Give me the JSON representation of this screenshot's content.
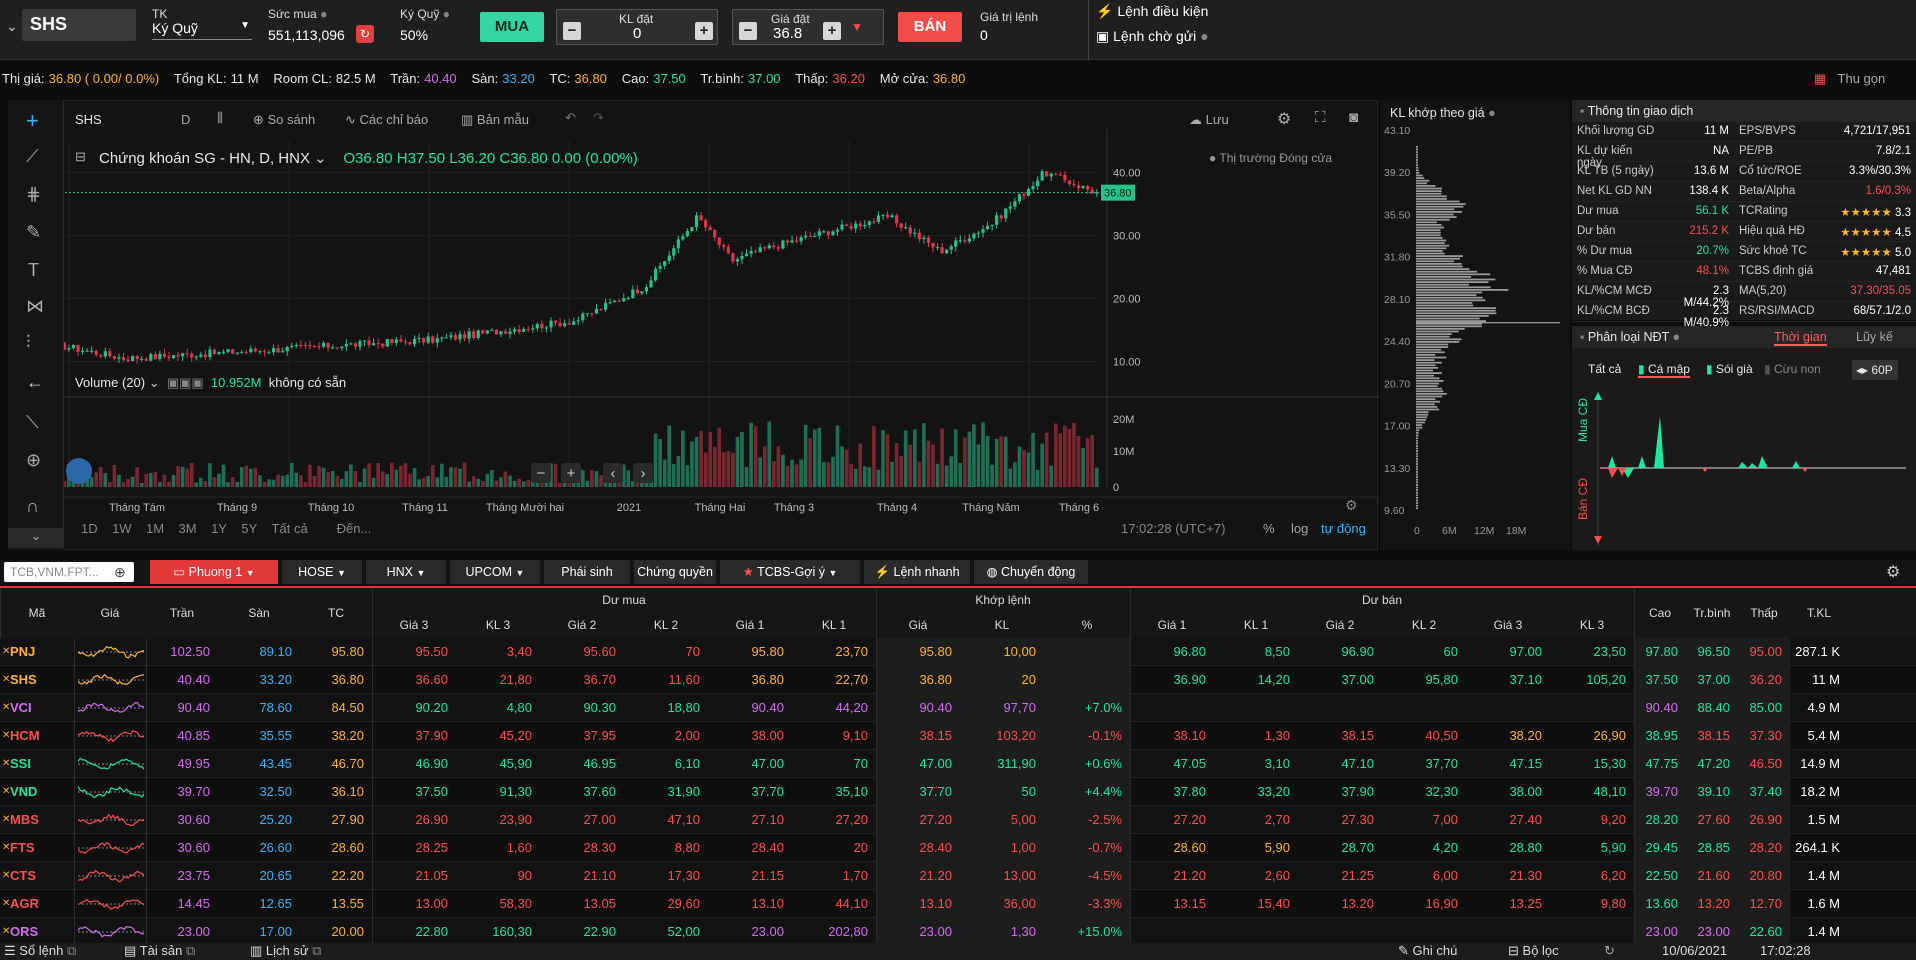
{
  "order": {
    "symbol": "SHS",
    "tk_label": "TK",
    "tk_value": "Ký Quỹ",
    "sucmua_label": "Sức mua",
    "sucmua_value": "551,113,096",
    "kyquy_label": "Ký Quỹ",
    "kyquy_value": "50%",
    "buy": "MUA",
    "kl_label": "KL đặt",
    "kl_value": "0",
    "gia_label": "Giá đặt",
    "gia_value": "36.8",
    "sell": "BÁN",
    "gtl_label": "Giá trị lệnh",
    "gtl_value": "0",
    "cond": "Lệnh điều kiện",
    "pending": "Lệnh chờ gửi"
  },
  "ticker": {
    "thigia_l": "Thị giá:",
    "thigia_v": "36.80 ( 0.00/ 0.0%)",
    "tongkl_l": "Tổng KL:",
    "tongkl_v": "11 M",
    "room_l": "Room CL:",
    "room_v": "82.5 M",
    "tran_l": "Trần:",
    "tran_v": "40.40",
    "san_l": "Sàn:",
    "san_v": "33.20",
    "tc_l": "TC:",
    "tc_v": "36.80",
    "cao_l": "Cao:",
    "cao_v": "37.50",
    "tb_l": "Tr.bình:",
    "tb_v": "37.00",
    "thap_l": "Thấp:",
    "thap_v": "36.20",
    "mo_l": "Mở cửa:",
    "mo_v": "36.80",
    "collapse": "Thu gọn"
  },
  "chart": {
    "sym": "SHS",
    "interval": "D",
    "compare": "So sánh",
    "indicators": "Các chỉ báo",
    "template": "Bản mẫu",
    "save": "Lưu",
    "name": "Chứng khoán SG - HN, D, HNX",
    "o": "O36.80",
    "h": "H37.50",
    "l": "L36.20",
    "c": "C36.80",
    "chg": "0.00 (0.00%)",
    "market": "Thị trường Đóng cửa",
    "vol_label": "Volume (20)",
    "vol_value": "10.952M",
    "vol_na": "không có sẵn",
    "last": "36.80",
    "yticks": [
      "40.00",
      "30.00",
      "20.00",
      "10.00"
    ],
    "vticks": [
      "20M",
      "10M",
      "0"
    ],
    "months": [
      "Tháng Tám",
      "Tháng 9",
      "Tháng 10",
      "Tháng 11",
      "Tháng Mười hai",
      "2021",
      "Tháng Hai",
      "Tháng 3",
      "Tháng 4",
      "Tháng Năm",
      "Tháng 6"
    ],
    "ranges": [
      "1D",
      "1W",
      "1M",
      "3M",
      "1Y",
      "5Y",
      "Tất cả",
      "Đến..."
    ],
    "time": "17:02:28 (UTC+7)",
    "pct": "%",
    "log": "log",
    "auto": "tự động"
  },
  "kl": {
    "title": "KL khớp theo giá",
    "prices": [
      "43.10",
      "39.20",
      "35.50",
      "31.80",
      "28.10",
      "24.40",
      "20.70",
      "17.00",
      "13.30",
      "9.60"
    ],
    "axis": [
      "0",
      "6M",
      "12M",
      "18M"
    ]
  },
  "info": {
    "title": "Thông tin giao dịch",
    "rows": [
      [
        "Khối lượng GD",
        "11 M",
        "EPS/BVPS",
        "4,721/17,951"
      ],
      [
        "KL dự kiến ngày",
        "NA",
        "PE/PB",
        "7.8/2.1"
      ],
      [
        "KL TB (5 ngày)",
        "13.6 M",
        "Cổ tức/ROE",
        "3.3%/30.3%"
      ],
      [
        "Net KL GD NN",
        "138.4 K",
        "Beta/Alpha",
        "1.6/0.3%"
      ],
      [
        "Dư mua",
        "56.1 K",
        "TCRating",
        "3.3"
      ],
      [
        "Dư bán",
        "215.2 K",
        "Hiệu quả HĐ",
        "4.5"
      ],
      [
        "% Dư mua",
        "20.7%",
        "Sức khoẻ TC",
        "5.0"
      ],
      [
        "% Mua CĐ",
        "48.1%",
        "TCBS định giá",
        "47,481"
      ],
      [
        "KL/%CM MCĐ",
        "2.3 M/44.2%",
        "MA(5,20)",
        "37.30/35.05"
      ],
      [
        "KL/%CM BCĐ",
        "2.3 M/40.9%",
        "RS/RSI/MACD",
        "68/57.1/2.0"
      ]
    ]
  },
  "ndt": {
    "title": "Phân loại NĐT",
    "t1": "Thời gian",
    "t2": "Lũy kế",
    "all": "Tất cả",
    "f1": "Cá mập",
    "f2": "Sói già",
    "f3": "Cừu non",
    "period": "60P",
    "mua": "Mua CĐ",
    "ban": "Bán CĐ"
  },
  "tabs": {
    "search": "TCB,VNM,FPT...",
    "items": [
      "Phuong 1",
      "HOSE",
      "HNX",
      "UPCOM",
      "Phái sinh",
      "Chứng quyền",
      "TCBS-Gợi ý",
      "Lệnh nhanh",
      "Chuyển động"
    ]
  },
  "board": {
    "h": {
      "ma": "Mã",
      "gia": "Giá",
      "tran": "Trần",
      "san": "Sàn",
      "tc": "TC",
      "dumua": "Dư mua",
      "khop": "Khớp lệnh",
      "duban": "Dư bán",
      "cao": "Cao",
      "tb": "Tr.bình",
      "thap": "Thấp",
      "tkl": "T.KL",
      "g3": "Giá 3",
      "k3": "KL 3",
      "g2": "Giá 2",
      "k2": "KL 2",
      "g1": "Giá 1",
      "k1": "KL 1",
      "kg": "Giá",
      "kk": "KL",
      "kp": "%"
    },
    "rows": [
      [
        "PNJ",
        "102.50",
        "89.10",
        "95.80",
        "95.50",
        "3,40",
        "95.60",
        "70",
        "95.80",
        "23,70",
        "95.80",
        "10,00",
        "",
        "96.80",
        "8,50",
        "96.90",
        "60",
        "97.00",
        "23,50",
        "97.80",
        "96.50",
        "95.00",
        "287.1 K"
      ],
      [
        "SHS",
        "40.40",
        "33.20",
        "36.80",
        "36.60",
        "21,80",
        "36.70",
        "11,60",
        "36.80",
        "22,70",
        "36.80",
        "20",
        "",
        "36.90",
        "14,20",
        "37.00",
        "95,80",
        "37.10",
        "105,20",
        "37.50",
        "37.00",
        "36.20",
        "11 M"
      ],
      [
        "VCI",
        "90.40",
        "78.60",
        "84.50",
        "90.20",
        "4,80",
        "90.30",
        "18,80",
        "90.40",
        "44,20",
        "90.40",
        "97,70",
        "+7.0%",
        "",
        "",
        "",
        "",
        "",
        "",
        "90.40",
        "88.40",
        "85.00",
        "4.9 M"
      ],
      [
        "HCM",
        "40.85",
        "35.55",
        "38.20",
        "37.90",
        "45,20",
        "37.95",
        "2,00",
        "38.00",
        "9,10",
        "38.15",
        "103,20",
        "-0.1%",
        "38.10",
        "1,30",
        "38.15",
        "40,50",
        "38.20",
        "26,90",
        "38.95",
        "38.15",
        "37.30",
        "5.4 M"
      ],
      [
        "SSI",
        "49.95",
        "43.45",
        "46.70",
        "46.90",
        "45,90",
        "46.95",
        "6,10",
        "47.00",
        "70",
        "47.00",
        "311,90",
        "+0.6%",
        "47.05",
        "3,10",
        "47.10",
        "37,70",
        "47.15",
        "15,30",
        "47.75",
        "47.20",
        "46.50",
        "14.9 M"
      ],
      [
        "VND",
        "39.70",
        "32.50",
        "36.10",
        "37.50",
        "91,30",
        "37.60",
        "31,90",
        "37.70",
        "35,10",
        "37.70",
        "50",
        "+4.4%",
        "37.80",
        "33,20",
        "37.90",
        "32,30",
        "38.00",
        "48,10",
        "39.70",
        "39.10",
        "37.40",
        "18.2 M"
      ],
      [
        "MBS",
        "30.60",
        "25.20",
        "27.90",
        "26.90",
        "23,90",
        "27.00",
        "47,10",
        "27.10",
        "27,20",
        "27.20",
        "5,00",
        "-2.5%",
        "27.20",
        "2,70",
        "27.30",
        "7,00",
        "27.40",
        "9,20",
        "28.20",
        "27.60",
        "26.90",
        "1.5 M"
      ],
      [
        "FTS",
        "30.60",
        "26.60",
        "28.60",
        "28.25",
        "1,60",
        "28.30",
        "8,80",
        "28.40",
        "20",
        "28.40",
        "1,00",
        "-0.7%",
        "28.60",
        "5,90",
        "28.70",
        "4,20",
        "28.80",
        "5,90",
        "29.45",
        "28.85",
        "28.20",
        "264.1 K"
      ],
      [
        "CTS",
        "23.75",
        "20.65",
        "22.20",
        "21.05",
        "90",
        "21.10",
        "17,30",
        "21.15",
        "1,70",
        "21.20",
        "13,00",
        "-4.5%",
        "21.20",
        "2,60",
        "21.25",
        "6,00",
        "21.30",
        "6,20",
        "22.50",
        "21.60",
        "20.80",
        "1.4 M"
      ],
      [
        "AGR",
        "14.45",
        "12.65",
        "13.55",
        "13.00",
        "58,30",
        "13.05",
        "29,60",
        "13.10",
        "44,10",
        "13.10",
        "36,00",
        "-3.3%",
        "13.15",
        "15,40",
        "13.20",
        "16,90",
        "13.25",
        "9,80",
        "13.60",
        "13.20",
        "12.70",
        "1.6 M"
      ],
      [
        "ORS",
        "23.00",
        "17.00",
        "20.00",
        "22.80",
        "160,30",
        "22.90",
        "52,00",
        "23.00",
        "202,80",
        "23.00",
        "1,30",
        "+15.0%",
        "",
        "",
        "",
        "",
        "",
        "",
        "23.00",
        "23.00",
        "22.60",
        "1.4 M"
      ]
    ]
  },
  "footer": {
    "solenh": "Sổ lệnh",
    "taisan": "Tài sản",
    "lichsu": "Lịch sử",
    "ghichu": "Ghi chú",
    "boloc": "Bộ lọc",
    "date": "10/06/2021",
    "time": "17:02:28"
  }
}
